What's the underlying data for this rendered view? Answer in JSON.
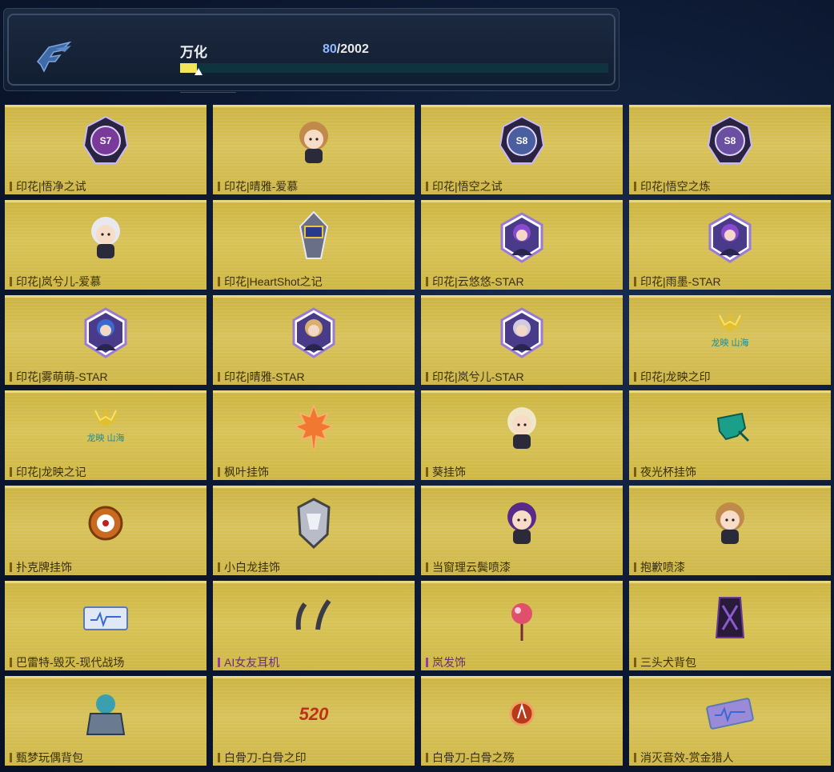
{
  "header": {
    "player_name": "万化",
    "progress_current": "80",
    "progress_total": "/2002",
    "progress_fraction": 0.04
  },
  "items": [
    {
      "label": "印花|悟净之试",
      "icon": "badge-s7-icon",
      "tag": "S7"
    },
    {
      "label": "印花|晴雅-爱慕",
      "icon": "chibi-girl-sticker-icon",
      "tag": ""
    },
    {
      "label": "印花|悟空之试",
      "icon": "badge-s8-icon",
      "tag": "S8"
    },
    {
      "label": "印花|悟空之炼",
      "icon": "badge-s8-purple-icon",
      "tag": "S8"
    },
    {
      "label": "印花|岚兮儿-爱慕",
      "icon": "chibi-white-hair-sticker-icon",
      "tag": ""
    },
    {
      "label": "印花|HeartShot之记",
      "icon": "heartshot-badge-icon",
      "tag": ""
    },
    {
      "label": "印花|云悠悠-STAR",
      "icon": "hexagon-portrait-icon",
      "tag": ""
    },
    {
      "label": "印花|雨墨-STAR",
      "icon": "heart-portrait-icon",
      "tag": ""
    },
    {
      "label": "印花|雾萌萌-STAR",
      "icon": "hexagon-portrait-blue-icon",
      "tag": ""
    },
    {
      "label": "印花|晴雅-STAR",
      "icon": "hexagon-portrait-blonde-icon",
      "tag": ""
    },
    {
      "label": "印花|岚兮儿-STAR",
      "icon": "hexagon-portrait-silver-icon",
      "tag": ""
    },
    {
      "label": "印花|龙映之印",
      "icon": "dragon-emblem-icon",
      "tag": "龙映 山海"
    },
    {
      "label": "印花|龙映之记",
      "icon": "dragon-emblem-gold-icon",
      "tag": "龙映 山海"
    },
    {
      "label": "枫叶挂饰",
      "icon": "maple-leaf-icon",
      "tag": ""
    },
    {
      "label": "葵挂饰",
      "icon": "chibi-eyepatch-icon",
      "tag": ""
    },
    {
      "label": "夜光杯挂饰",
      "icon": "green-cup-icon",
      "tag": ""
    },
    {
      "label": "扑克牌挂饰",
      "icon": "poker-chip-icon",
      "tag": ""
    },
    {
      "label": "小白龙挂饰",
      "icon": "white-dragon-mask-icon",
      "tag": ""
    },
    {
      "label": "当窗理云鬓喷漆",
      "icon": "spray-girl-icon",
      "tag": ""
    },
    {
      "label": "抱歉喷漆",
      "icon": "spray-boy-icon",
      "tag": ""
    },
    {
      "label": "巴雷特-毁灭-现代战场",
      "icon": "weapon-card-icon",
      "tag": ""
    },
    {
      "label": "AI女友耳机",
      "icon": "headphones-icon",
      "tag": "",
      "purple": true
    },
    {
      "label": "岚发饰",
      "icon": "hair-ornament-icon",
      "tag": "",
      "purple": true
    },
    {
      "label": "三头犬背包",
      "icon": "cerberus-backpack-icon",
      "tag": ""
    },
    {
      "label": "甄梦玩偶背包",
      "icon": "doll-backpack-icon",
      "tag": ""
    },
    {
      "label": "白骨刀-白骨之印",
      "icon": "bone-blade-emblem-icon",
      "tag": "520"
    },
    {
      "label": "白骨刀-白骨之殇",
      "icon": "bone-blade-badge-icon",
      "tag": ""
    },
    {
      "label": "消灭音效-赏金猎人",
      "icon": "sound-card-icon",
      "tag": ""
    }
  ],
  "colors": {
    "card_gold": "#d4bd52",
    "progress_fill": "#f4e45a",
    "progress_track": "#0f3440",
    "accent_blue": "#8fb8ff"
  }
}
